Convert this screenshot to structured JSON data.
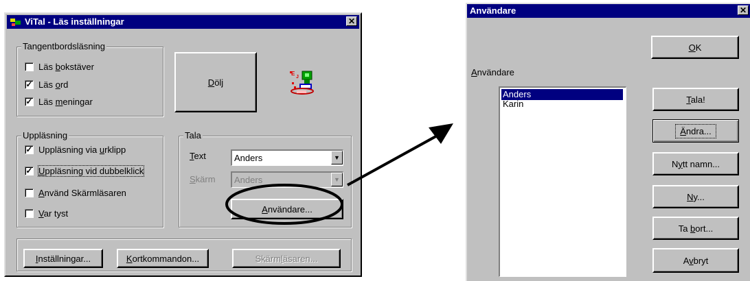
{
  "left_dialog": {
    "title": "ViTal - Läs inställningar",
    "group_keyboard": {
      "label": "Tangentbordsläsning",
      "items": [
        {
          "pre": "Läs ",
          "ul": "b",
          "post": "okstäver",
          "checked": false
        },
        {
          "pre": "Läs ",
          "ul": "o",
          "post": "rd",
          "checked": true
        },
        {
          "pre": "Läs ",
          "ul": "m",
          "post": "eningar",
          "checked": true
        }
      ]
    },
    "hide_button": {
      "ul": "D",
      "post": "ölj"
    },
    "group_reading": {
      "label": "Uppläsning",
      "items": [
        {
          "pre": "Uppläsning via ",
          "ul": "u",
          "post": "rklipp",
          "checked": true
        },
        {
          "pre": "",
          "ul": "U",
          "post": "ppläsning vid dubbelklick",
          "checked": true
        },
        {
          "pre": "",
          "ul": "A",
          "post": "nvänd Skärmläsaren",
          "checked": false
        },
        {
          "pre": "",
          "ul": "V",
          "post": "ar tyst",
          "checked": false
        }
      ]
    },
    "group_speak": {
      "label": "Tala",
      "text_label": {
        "ul": "T",
        "post": "ext"
      },
      "text_value": "Anders",
      "screen_label": {
        "ul": "S",
        "post": "kärm"
      },
      "screen_value": "Anders",
      "users_button": {
        "ul": "A",
        "post": "nvändare..."
      }
    },
    "bottom_buttons": {
      "settings": {
        "pre": "",
        "ul": "I",
        "post": "nställningar..."
      },
      "shortcuts": {
        "pre": "",
        "ul": "K",
        "post": "ortkommandon..."
      },
      "screenreader": {
        "pre": "Skärm",
        "ul": "l",
        "post": "äsaren..."
      }
    }
  },
  "right_dialog": {
    "title": "Användare",
    "ok": {
      "ul": "O",
      "post": "K"
    },
    "list_label": {
      "pre": "",
      "ul": "A",
      "post": "nvändare"
    },
    "users": [
      {
        "name": "Anders",
        "selected": true
      },
      {
        "name": "Karin",
        "selected": false
      }
    ],
    "buttons": {
      "speak": {
        "pre": "",
        "ul": "T",
        "post": "ala!"
      },
      "change": {
        "pre": "",
        "ul": "Ä",
        "post": "ndra..."
      },
      "new_name": {
        "pre": "N",
        "ul": "y",
        "post": "tt namn..."
      },
      "new": {
        "pre": "",
        "ul": "N",
        "post": "y..."
      },
      "remove": {
        "pre": "Ta ",
        "ul": "b",
        "post": "ort..."
      },
      "cancel": {
        "pre": "A",
        "ul": "v",
        "post": "bryt"
      }
    }
  },
  "colors": {
    "face": "#c0c0c0",
    "title": "#000080",
    "highlight": "#000080"
  },
  "icons": [
    "vital-app-icon",
    "close-icon",
    "dropdown-arrow-icon",
    "robot-reading-icon",
    "callout-ellipse",
    "arrow-annotation"
  ]
}
